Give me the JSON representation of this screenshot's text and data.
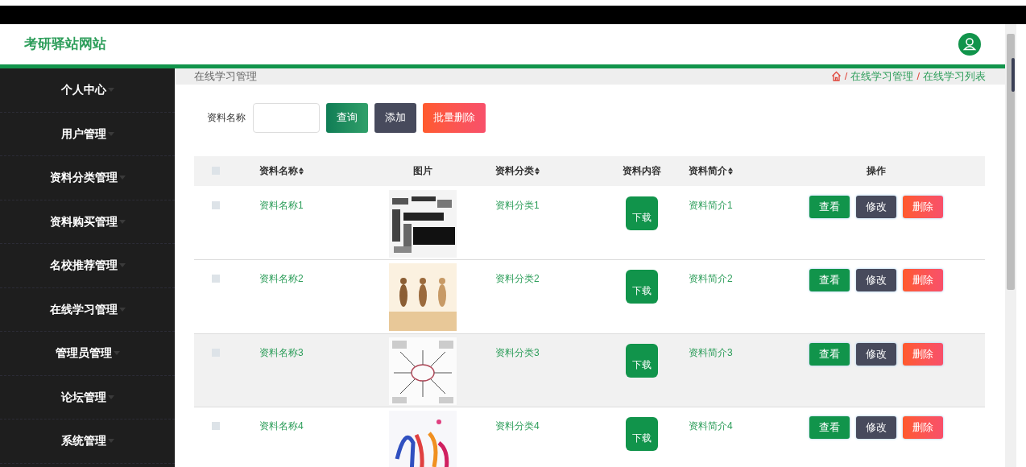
{
  "header": {
    "title": "考研驿站网站"
  },
  "sidebar": {
    "items": [
      {
        "label": "个人中心"
      },
      {
        "label": "用户管理"
      },
      {
        "label": "资料分类管理"
      },
      {
        "label": "资料购买管理"
      },
      {
        "label": "名校推荐管理"
      },
      {
        "label": "在线学习管理"
      },
      {
        "label": "管理员管理"
      },
      {
        "label": "论坛管理"
      },
      {
        "label": "系统管理"
      }
    ]
  },
  "page_title": "在线学习管理",
  "breadcrumb": [
    {
      "separator": "/",
      "label": "在线学习管理"
    },
    {
      "separator": "/",
      "label": "在线学习列表"
    }
  ],
  "search": {
    "label": "资料名称",
    "buttons": [
      {
        "label": "查询",
        "kind": "search"
      },
      {
        "label": "添加",
        "kind": "add"
      },
      {
        "label": "批量删除",
        "kind": "delete"
      }
    ]
  },
  "table": {
    "select_all": {
      "checked": false
    },
    "columns": [
      {
        "label": "资料名称",
        "sortable": true
      },
      {
        "label": "图片",
        "sortable": false
      },
      {
        "label": "资料分类",
        "sortable": true
      },
      {
        "label": "资料内容",
        "sortable": false
      },
      {
        "label": "资料简介",
        "sortable": true
      },
      {
        "label": "操作",
        "sortable": false
      }
    ],
    "rows": [
      {
        "checked": false,
        "hovered": false,
        "name": "资料名称1",
        "image": {
          "kind": "picture"
        },
        "category": "资料分类1",
        "content_button": "下载",
        "intro": "资料简介1",
        "actions": [
          "查看",
          "修改",
          "删除"
        ]
      },
      {
        "checked": false,
        "hovered": false,
        "name": "资料名称2",
        "image": {
          "kind": "picture"
        },
        "category": "资料分类2",
        "content_button": "下载",
        "intro": "资料简介2",
        "actions": [
          "查看",
          "修改",
          "删除"
        ]
      },
      {
        "checked": false,
        "hovered": true,
        "name": "资料名称3",
        "image": {
          "kind": "picture"
        },
        "category": "资料分类3",
        "content_button": "下载",
        "intro": "资料简介3",
        "actions": [
          "查看",
          "修改",
          "删除"
        ]
      },
      {
        "checked": false,
        "hovered": false,
        "name": "资料名称4",
        "image": {
          "kind": "picture"
        },
        "category": "资料分类4",
        "content_button": "下载",
        "intro": "资料简介4",
        "actions": [
          "查看",
          "修改",
          "删除"
        ]
      }
    ]
  }
}
